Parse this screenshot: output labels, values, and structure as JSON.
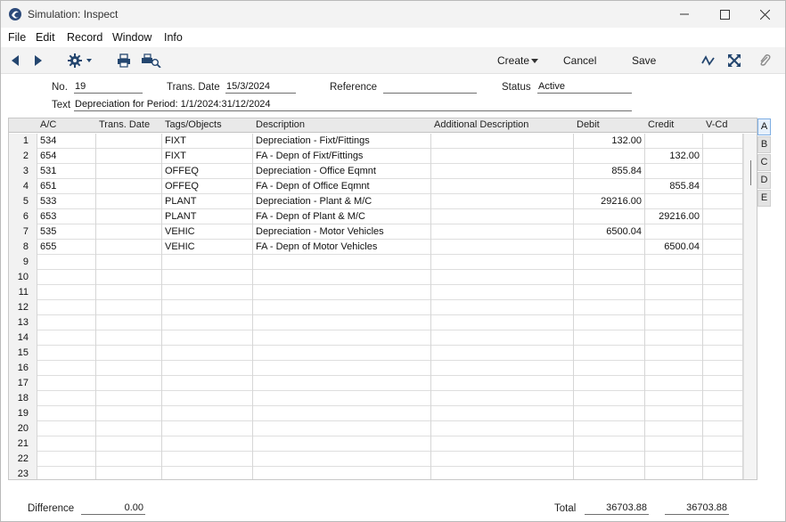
{
  "window": {
    "title": "Simulation: Inspect"
  },
  "menu": [
    "File",
    "Edit",
    "Record",
    "Window",
    "Info"
  ],
  "toolbar": {
    "icons": [
      "back-arrow-icon",
      "forward-arrow-icon",
      "gear-icon",
      "print-icon",
      "print-preview-icon",
      "activity-icon",
      "expand-icon",
      "paperclip-icon"
    ],
    "create_label": "Create",
    "cancel_label": "Cancel",
    "save_label": "Save"
  },
  "header": {
    "no_label": "No.",
    "no_value": "19",
    "trans_date_label": "Trans. Date",
    "trans_date_value": "15/3/2024",
    "reference_label": "Reference",
    "reference_value": "",
    "status_label": "Status",
    "status_value": "Active",
    "text_label": "Text",
    "text_value": "Depreciation for Period: 1/1/2024:31/12/2024"
  },
  "grid": {
    "columns": [
      "A/C",
      "Trans. Date",
      "Tags/Objects",
      "Description",
      "Additional Description",
      "Debit",
      "Credit",
      "V-Cd"
    ],
    "rows": [
      {
        "n": "1",
        "ac": "534",
        "date": "",
        "tags": "FIXT",
        "desc": "Depreciation - Fixt/Fittings",
        "adesc": "",
        "debit": "132.00",
        "credit": "",
        "vcd": ""
      },
      {
        "n": "2",
        "ac": "654",
        "date": "",
        "tags": "FIXT",
        "desc": "FA - Depn of Fixt/Fittings",
        "adesc": "",
        "debit": "",
        "credit": "132.00",
        "vcd": ""
      },
      {
        "n": "3",
        "ac": "531",
        "date": "",
        "tags": "OFFEQ",
        "desc": "Depreciation - Office Eqmnt",
        "adesc": "",
        "debit": "855.84",
        "credit": "",
        "vcd": ""
      },
      {
        "n": "4",
        "ac": "651",
        "date": "",
        "tags": "OFFEQ",
        "desc": "FA - Depn of Office Eqmnt",
        "adesc": "",
        "debit": "",
        "credit": "855.84",
        "vcd": ""
      },
      {
        "n": "5",
        "ac": "533",
        "date": "",
        "tags": "PLANT",
        "desc": "Depreciation - Plant & M/C",
        "adesc": "",
        "debit": "29216.00",
        "credit": "",
        "vcd": ""
      },
      {
        "n": "6",
        "ac": "653",
        "date": "",
        "tags": "PLANT",
        "desc": "FA - Depn of Plant & M/C",
        "adesc": "",
        "debit": "",
        "credit": "29216.00",
        "vcd": ""
      },
      {
        "n": "7",
        "ac": "535",
        "date": "",
        "tags": "VEHIC",
        "desc": "Depreciation - Motor Vehicles",
        "adesc": "",
        "debit": "6500.04",
        "credit": "",
        "vcd": ""
      },
      {
        "n": "8",
        "ac": "655",
        "date": "",
        "tags": "VEHIC",
        "desc": "FA - Depn of Motor Vehicles",
        "adesc": "",
        "debit": "",
        "credit": "6500.04",
        "vcd": ""
      },
      {
        "n": "9"
      },
      {
        "n": "10"
      },
      {
        "n": "11"
      },
      {
        "n": "12"
      },
      {
        "n": "13"
      },
      {
        "n": "14"
      },
      {
        "n": "15"
      },
      {
        "n": "16"
      },
      {
        "n": "17"
      },
      {
        "n": "18"
      },
      {
        "n": "19"
      },
      {
        "n": "20"
      },
      {
        "n": "21"
      },
      {
        "n": "22"
      },
      {
        "n": "23"
      }
    ]
  },
  "side_tabs": [
    "A",
    "B",
    "C",
    "D",
    "E"
  ],
  "side_tab_active": "A",
  "footer": {
    "difference_label": "Difference",
    "difference_value": "0.00",
    "total_label": "Total",
    "total_debit": "36703.88",
    "total_credit": "36703.88"
  }
}
